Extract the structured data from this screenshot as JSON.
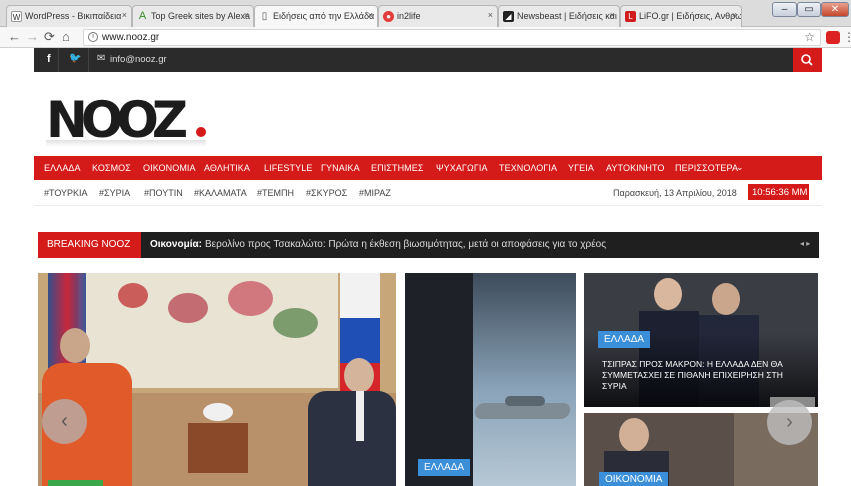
{
  "browser": {
    "tabs": [
      {
        "title": "WordPress - Βικιπαίδεια",
        "favicon": "W"
      },
      {
        "title": "Top Greek sites by Alexa",
        "favicon": "A"
      },
      {
        "title": "Ειδήσεις από την Ελλάδα",
        "favicon": "▯"
      },
      {
        "title": "in2life",
        "favicon": "●"
      },
      {
        "title": "Newsbeast | Ειδήσεις και",
        "favicon": "◢"
      },
      {
        "title": "LiFO.gr | Ειδήσεις, Ανθρω",
        "favicon": "L"
      }
    ],
    "address": "www.nooz.gr",
    "tab_close": "×",
    "window_buttons": [
      "‒",
      "▭",
      "✕"
    ]
  },
  "site": {
    "email": "info@nooz.gr",
    "logo": "NOOZ",
    "nav": [
      "ΕΛΛΑΔΑ",
      "ΚΟΣΜΟΣ",
      "ΟΙΚΟΝΟΜΙΑ",
      "ΑΘΛΗΤΙΚΑ",
      "LIFESTYLE",
      "ΓΥΝΑΙΚΑ",
      "ΕΠΙΣΤΗΜΕΣ",
      "ΨΥΧΑΓΩΓΙΑ",
      "ΤΕΧΝΟΛΟΓΙΑ",
      "ΥΓΕΙΑ",
      "ΑΥΤΟΚΙΝΗΤΟ",
      "ΠΕΡΙΣΣΟΤΕΡΑ"
    ],
    "tags": [
      "#ΤΟΥΡΚΙΑ",
      "#ΣΥΡΙΑ",
      "#ΠΟΥΤΙΝ",
      "#ΚΑΛΑΜΑΤΑ",
      "#ΤΕΜΠΗ",
      "#ΣΚΥΡΟΣ",
      "#ΜΙΡΑΖ"
    ],
    "date": "Παρασκευή, 13 Απριλίου, 2018",
    "time": "10:56:36 MM",
    "breaking_label": "BREAKING NOOZ",
    "breaking_category": "Οικονομία:",
    "breaking_text": "Βερολίνο προς Τσακαλώτο: Πρώτα η έκθεση βιωσιμότητας, μετά οι αποφάσεις για το χρέος",
    "cards": [
      {
        "badge": ""
      },
      {
        "badge": "ΕΛΛΑΔΑ"
      },
      {
        "badge": "ΕΛΛΑΔΑ",
        "headline": "ΤΣΙΠΡΑΣ ΠΡΟΣ ΜΑΚΡΟΝ: Η ΕΛΛΑΔΑ ΔΕΝ ΘΑ ΣΥΜΜΕΤΑΣΧΕΙ ΣΕ ΠΙΘΑΝΗ ΕΠΙΧΕΙΡΗΣΗ ΣΤΗ ΣΥΡΙΑ"
      },
      {
        "badge": "ΟΙΚΟΝΟΜΙΑ"
      }
    ]
  }
}
